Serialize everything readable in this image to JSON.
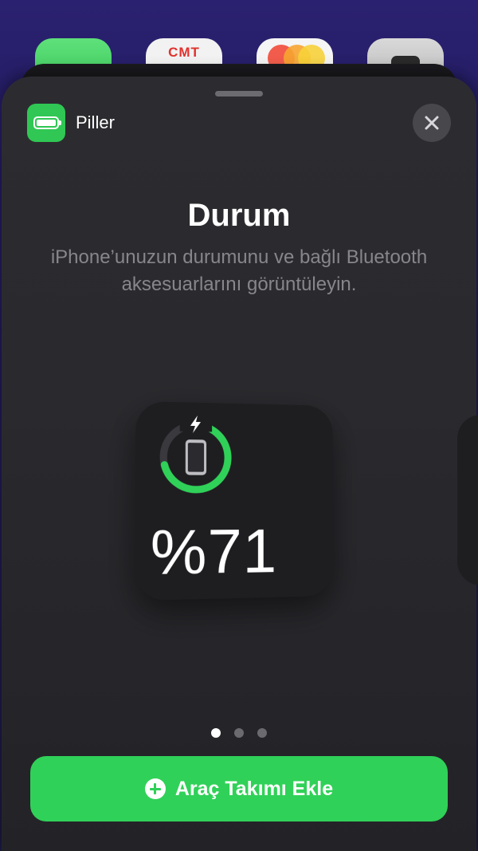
{
  "background_icons": {
    "cmt_label": "CMT"
  },
  "sheet": {
    "app_name": "Piller",
    "app_icon": "battery-icon",
    "close_icon": "close-icon"
  },
  "widget_gallery": {
    "title": "Durum",
    "subtitle_line1": "iPhone’unuzun durumunu ve bağlı Bluetooth",
    "subtitle_line2": "aksesuarlarını görüntüleyin."
  },
  "widget": {
    "percent_label": "%71",
    "charge_level": 0.71,
    "charging": true,
    "device_icon": "iphone-icon",
    "ring_color": "#30d158"
  },
  "pagination": {
    "pages": 3,
    "active": 0
  },
  "add_button": {
    "label": "Araç Takımı Ekle",
    "color": "#30d158"
  }
}
